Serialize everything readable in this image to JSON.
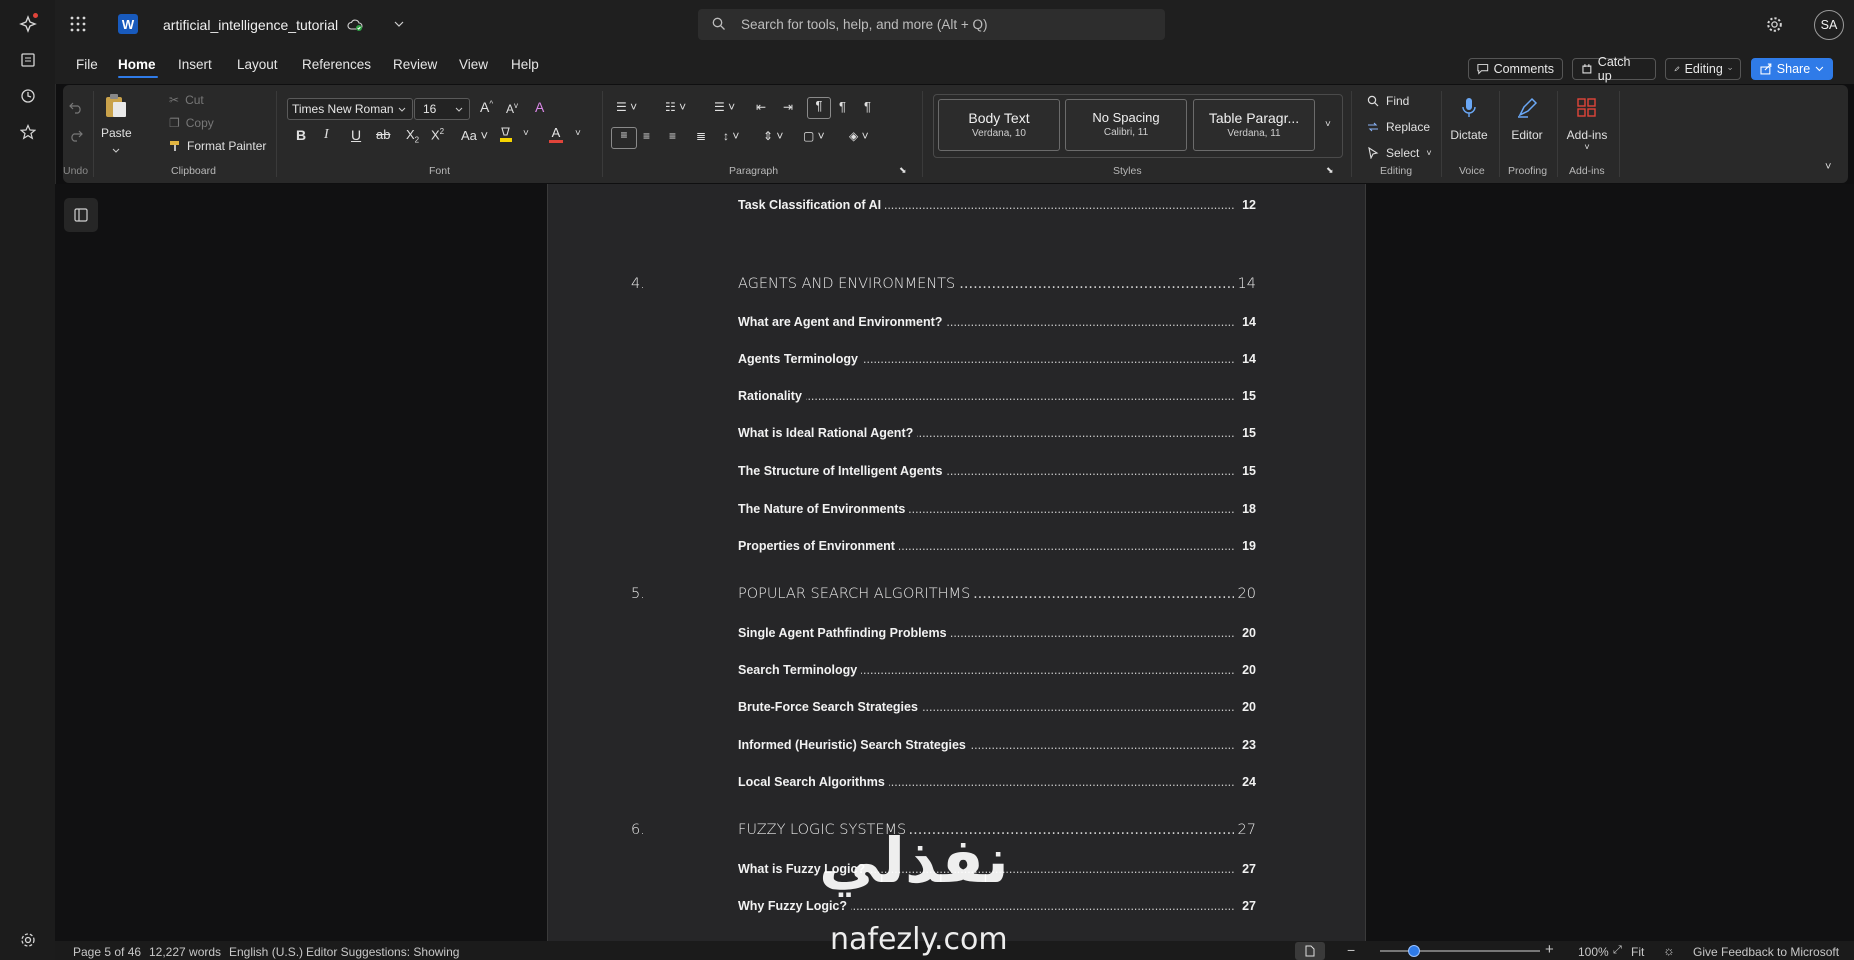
{
  "title_bar": {
    "doc_title": "artificial_intelligence_tutorial",
    "app_icon_letter": "W",
    "search_placeholder": "Search for tools, help, and more (Alt + Q)",
    "avatar_initials": "SA"
  },
  "menu_tabs": [
    "File",
    "Home",
    "Insert",
    "Layout",
    "References",
    "Review",
    "View",
    "Help"
  ],
  "active_tab": "Home",
  "top_actions": {
    "comments": "Comments",
    "catch_up": "Catch up",
    "editing": "Editing",
    "share": "Share"
  },
  "ribbon": {
    "undo_group": "Undo",
    "clipboard": {
      "paste": "Paste",
      "cut": "Cut",
      "copy": "Copy",
      "format_painter": "Format Painter",
      "group": "Clipboard"
    },
    "font": {
      "family": "Times New Roman",
      "size": "16",
      "group": "Font"
    },
    "paragraph": {
      "group": "Paragraph"
    },
    "styles": {
      "group": "Styles",
      "cards": [
        {
          "name": "Body Text",
          "font": "Verdana, 10"
        },
        {
          "name": "No Spacing",
          "font": "Calibri, 11"
        },
        {
          "name": "Table Paragr...",
          "font": "Verdana, 11"
        }
      ]
    },
    "editing": {
      "find": "Find",
      "replace": "Replace",
      "select": "Select",
      "group": "Editing"
    },
    "voice": {
      "dictate": "Dictate",
      "group": "Voice"
    },
    "proofing": {
      "editor": "Editor",
      "group": "Proofing"
    },
    "addins": {
      "label": "Add-ins",
      "group": "Add-ins"
    }
  },
  "toc": [
    {
      "kind": "sub",
      "text": "Task Classification of AI",
      "page": "12"
    },
    {
      "kind": "chap",
      "num": "4.",
      "text": "AGENTS AND ENVIRONMENTS",
      "page": "14"
    },
    {
      "kind": "sub",
      "text": "What are Agent and Environment?",
      "page": "14"
    },
    {
      "kind": "sub",
      "text": "Agents Terminology",
      "page": "14"
    },
    {
      "kind": "sub",
      "text": "Rationality",
      "page": "15"
    },
    {
      "kind": "sub",
      "text": "What is Ideal Rational Agent?",
      "page": "15"
    },
    {
      "kind": "sub",
      "text": "The Structure of Intelligent Agents",
      "page": "15"
    },
    {
      "kind": "sub",
      "text": "The Nature of Environments",
      "page": "18"
    },
    {
      "kind": "sub",
      "text": "Properties of Environment",
      "page": "19"
    },
    {
      "kind": "chap",
      "num": "5.",
      "text": "POPULAR SEARCH ALGORITHMS",
      "page": "20"
    },
    {
      "kind": "sub",
      "text": "Single Agent Pathfinding Problems",
      "page": "20"
    },
    {
      "kind": "sub",
      "text": "Search Terminology",
      "page": "20"
    },
    {
      "kind": "sub",
      "text": "Brute-Force Search Strategies",
      "page": "20"
    },
    {
      "kind": "sub",
      "text": "Informed (Heuristic) Search Strategies",
      "page": "23"
    },
    {
      "kind": "sub",
      "text": "Local Search Algorithms",
      "page": "24"
    },
    {
      "kind": "chap",
      "num": "6.",
      "text": "FUZZY LOGIC SYSTEMS",
      "page": "27"
    },
    {
      "kind": "sub",
      "text": "What is Fuzzy Logic?",
      "page": "27"
    },
    {
      "kind": "sub",
      "text": "Why Fuzzy Logic?",
      "page": "27"
    }
  ],
  "status": {
    "page": "Page 5 of 46",
    "words": "12,227 words",
    "language": "English (U.S.)",
    "editor": "Editor Suggestions: Showing",
    "zoom": "100%",
    "fit": "Fit",
    "feedback": "Give Feedback to Microsoft"
  },
  "watermark": {
    "arabic": "نفذلي",
    "latin": "nafezly.com"
  },
  "colors": {
    "accent": "#2f7be8",
    "word_blue": "#185abd",
    "font_red": "#e0443a",
    "highlight_yellow": "#f5d400",
    "sync_green": "#2ea043"
  }
}
